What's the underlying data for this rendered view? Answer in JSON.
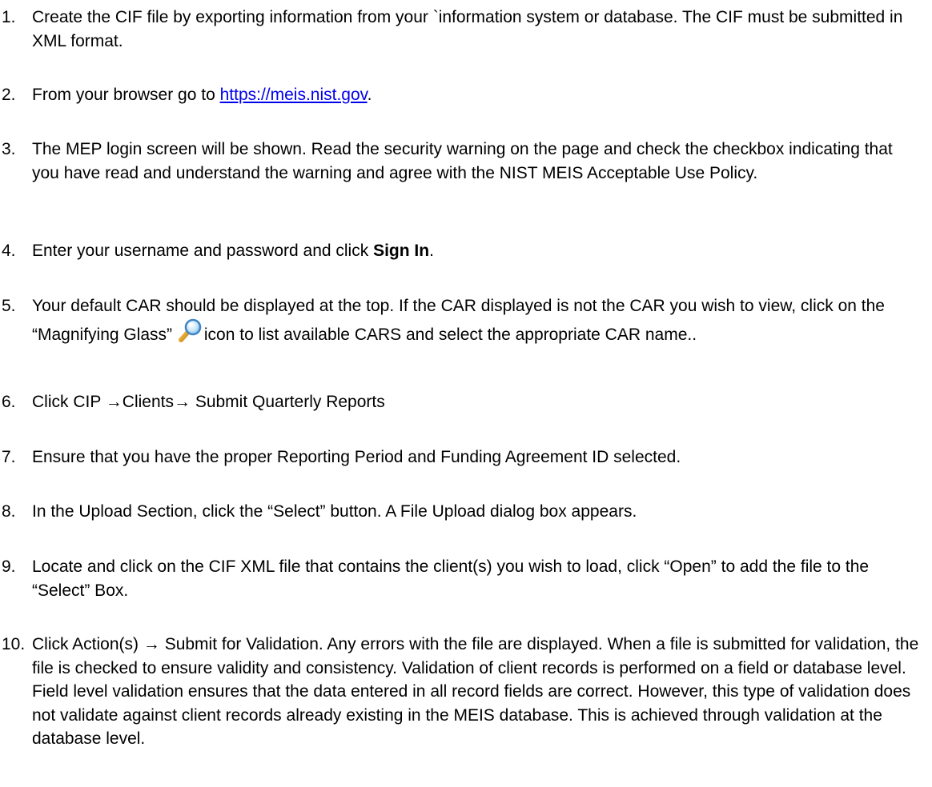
{
  "steps": [
    {
      "num": "1.",
      "text": "Create the CIF file by exporting information from your `information system or database. The CIF must be submitted in XML format."
    },
    {
      "num": "2.",
      "pre": "From your browser go to ",
      "link": "https://meis.nist.gov",
      "post": "."
    },
    {
      "num": "3.",
      "text": "The MEP login screen will be shown. Read the security warning on the page and check the checkbox indicating that you have read and understand the warning and agree with the NIST MEIS Acceptable Use Policy."
    },
    {
      "num": "4.",
      "pre": "Enter your username and password and click ",
      "bold": "Sign In",
      "post": "."
    },
    {
      "num": "5.",
      "pre": "Your default CAR should be displayed at the top. If the CAR displayed is not the CAR you wish to view, click on the “Magnifying Glass” ",
      "icon": "magnifying-glass-icon",
      "post": "icon to list available CARS and select the appropriate CAR name.."
    },
    {
      "num": "6.",
      "text": "Click CIP →Clients→ Submit Quarterly Reports"
    },
    {
      "num": "7.",
      "text": "Ensure that you have the proper Reporting Period and Funding Agreement ID selected."
    },
    {
      "num": "8.",
      "text": "In the Upload Section, click the “Select” button. A File Upload dialog box appears."
    },
    {
      "num": "9.",
      "text": "Locate and click on the CIF XML file that contains the client(s) you wish to load, click “Open” to add the file to the “Select” Box."
    },
    {
      "num": "10.",
      "text": "Click Action(s) → Submit for Validation. Any errors with the file are displayed. When a file is submitted for validation, the file is checked to ensure validity and consistency. Validation of client records is performed on a field or database level. Field level validation ensures that the data entered in all record fields are correct. However, this type of validation does not validate against client records already existing in the MEIS database. This is achieved through validation at the database level."
    }
  ]
}
